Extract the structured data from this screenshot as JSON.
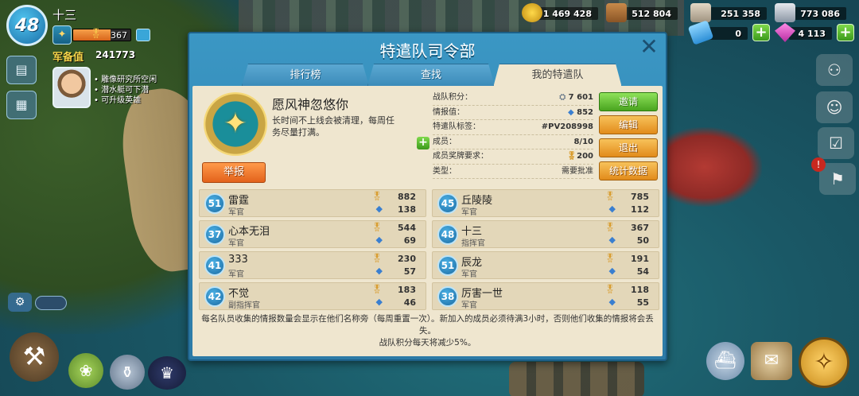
{
  "hud": {
    "level": "48",
    "player_name": "十三",
    "medals": "367",
    "medal_fraction": 0.65,
    "army_label": "军备值",
    "army_value": "241773",
    "notices": [
      "雕像研究所空闲",
      "潜水艇可下潜",
      "可升级英雄"
    ]
  },
  "resources": {
    "gold": "1 469 428",
    "wood": "512 804",
    "stone": "251 358",
    "iron": "773 086",
    "tickets": "0",
    "diamonds": "4 113"
  },
  "dialog": {
    "title": "特遣队司令部",
    "tabs": [
      "排行榜",
      "查找",
      "我的特遣队"
    ],
    "active_tab": 2,
    "team": {
      "name": "愿风神忽悠你",
      "description": "长时间不上线会被清理，每周任务尽量打满。",
      "report_label": "举报"
    },
    "stats": [
      {
        "label": "战队积分：",
        "value": "7 601"
      },
      {
        "label": "情报值：",
        "value": "852"
      },
      {
        "label": "特遣队标签：",
        "value": "#PV208998"
      },
      {
        "label": "成员：",
        "value": "8/10"
      },
      {
        "label": "成员奖牌要求：",
        "value": "200"
      },
      {
        "label": "类型：",
        "value": "需要批准"
      }
    ],
    "actions": [
      "邀请",
      "编辑",
      "退出",
      "统计数据"
    ],
    "members": [
      {
        "level": "51",
        "name": "雷霆",
        "rank": "军官",
        "medals": "882",
        "intel": "138"
      },
      {
        "level": "45",
        "name": "丘陵陵",
        "rank": "军官",
        "medals": "785",
        "intel": "112"
      },
      {
        "level": "37",
        "name": "心本无泪",
        "rank": "军官",
        "medals": "544",
        "intel": "69"
      },
      {
        "level": "48",
        "name": "十三",
        "rank": "指挥官",
        "medals": "367",
        "intel": "50"
      },
      {
        "level": "41",
        "name": "333",
        "rank": "军官",
        "medals": "230",
        "intel": "57"
      },
      {
        "level": "51",
        "name": "辰龙",
        "rank": "军官",
        "medals": "191",
        "intel": "54"
      },
      {
        "level": "42",
        "name": "不觉",
        "rank": "副指挥官",
        "medals": "183",
        "intel": "46"
      },
      {
        "level": "38",
        "name": "厉害一世",
        "rank": "军官",
        "medals": "118",
        "intel": "55"
      }
    ],
    "footer_line1": "每名队员收集的情报数量会显示在他们名称旁（每周重置一次）。新加入的成员必须待满3小时，否则他们收集的情报将会丢失。",
    "footer_line2": "战队积分每天将减少5%。"
  },
  "colors": {
    "dialog_blue": "#3b97c4",
    "panel_cream": "#efe6cf",
    "green_button": "#49a41f",
    "orange_button": "#e28b1b",
    "report_button": "#e3621b"
  },
  "icons": [
    "gold-icon",
    "wood-icon",
    "stone-icon",
    "iron-icon",
    "ticket-icon",
    "diamond-icon",
    "medal-icon",
    "intel-icon",
    "close-icon",
    "hammer-icon",
    "compass-icon"
  ]
}
